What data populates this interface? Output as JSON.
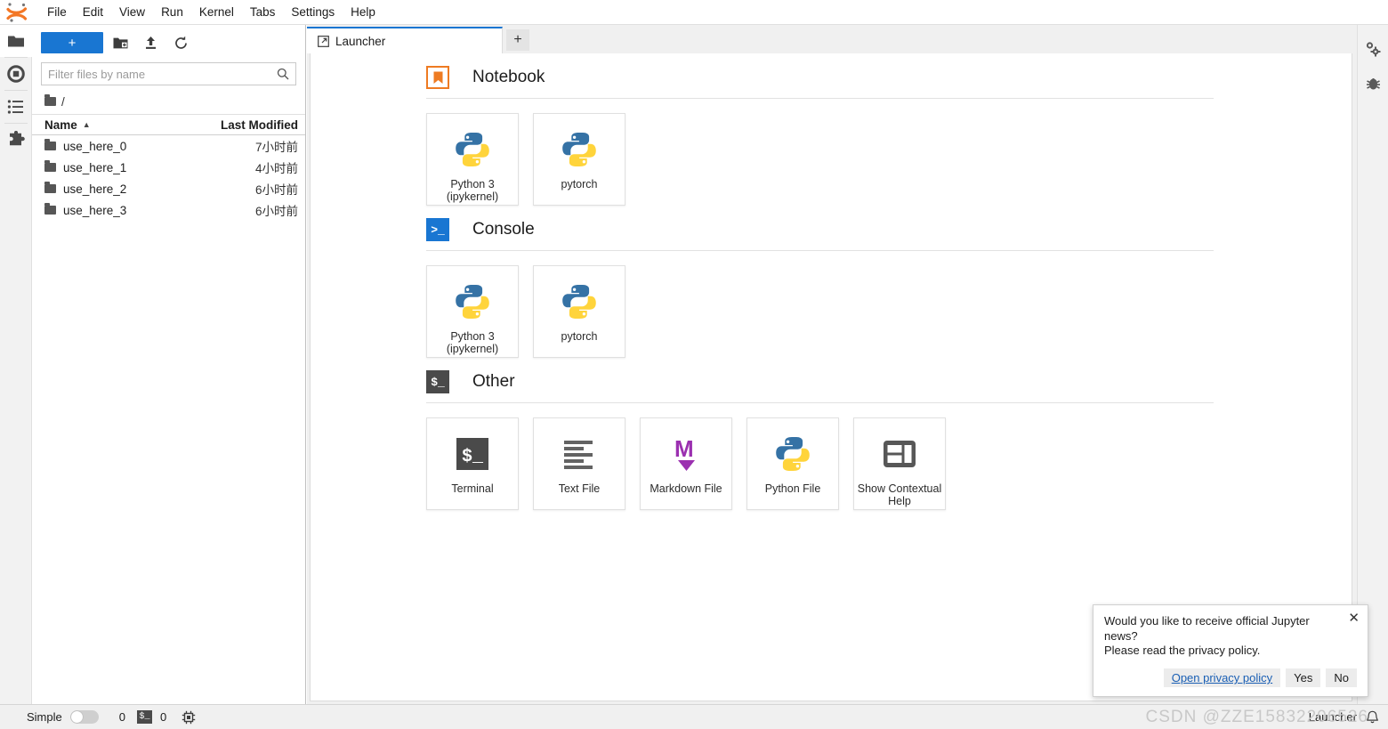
{
  "menubar": {
    "logo": "jupyter-logo",
    "items": [
      "File",
      "Edit",
      "View",
      "Run",
      "Kernel",
      "Tabs",
      "Settings",
      "Help"
    ]
  },
  "activitybar": {
    "items": [
      {
        "name": "file-browser",
        "icon": "folder-icon",
        "active": true
      },
      {
        "name": "running-sessions",
        "icon": "stop-circle-icon",
        "active": false
      },
      {
        "name": "commands",
        "icon": "list-icon",
        "active": false
      },
      {
        "name": "extension-manager",
        "icon": "puzzle-icon",
        "active": false
      }
    ]
  },
  "filebrowser": {
    "toolbar": {
      "new_label": "+",
      "new_folder_icon": "new-folder-icon",
      "upload_icon": "upload-icon",
      "refresh_icon": "refresh-icon"
    },
    "filter": {
      "placeholder": "Filter files by name",
      "value": "",
      "icon": "search-icon"
    },
    "breadcrumb": {
      "home_icon": "folder-icon",
      "path": "/"
    },
    "columns": [
      "Name",
      "Last Modified"
    ],
    "sort_caret": "▲",
    "rows": [
      {
        "name": "use_here_0",
        "modified": "7小时前"
      },
      {
        "name": "use_here_1",
        "modified": "4小时前"
      },
      {
        "name": "use_here_2",
        "modified": "6小时前"
      },
      {
        "name": "use_here_3",
        "modified": "6小时前"
      }
    ]
  },
  "dock": {
    "tab": {
      "label": "Launcher",
      "icon": "launcher-icon"
    },
    "add_tab_label": "+"
  },
  "launcher": {
    "sections": [
      {
        "title": "Notebook",
        "badge": "notebook-bookmark-icon",
        "badge_text": "",
        "cards": [
          {
            "label": "Python 3\n(ipykernel)",
            "icon": "python-icon"
          },
          {
            "label": "pytorch",
            "icon": "python-icon"
          }
        ]
      },
      {
        "title": "Console",
        "badge": "console-prompt-icon",
        "badge_text": ">_",
        "cards": [
          {
            "label": "Python 3\n(ipykernel)",
            "icon": "python-icon"
          },
          {
            "label": "pytorch",
            "icon": "python-icon"
          }
        ]
      },
      {
        "title": "Other",
        "badge": "terminal-prompt-icon",
        "badge_text": "$_",
        "cards": [
          {
            "label": "Terminal",
            "icon": "terminal-icon"
          },
          {
            "label": "Text File",
            "icon": "text-file-icon"
          },
          {
            "label": "Markdown File",
            "icon": "markdown-icon"
          },
          {
            "label": "Python File",
            "icon": "python-icon"
          },
          {
            "label": "Show Contextual Help",
            "icon": "contextual-help-icon"
          }
        ]
      }
    ]
  },
  "rightbar": {
    "items": [
      {
        "name": "property-inspector",
        "icon": "gears-icon"
      },
      {
        "name": "debugger",
        "icon": "bug-icon"
      }
    ]
  },
  "statusbar": {
    "simple_label": "Simple",
    "simple_on": false,
    "kernel_count": "0",
    "terminal_badge": "$_",
    "terminal_count": "0",
    "resource_icon": "cpu-chip-icon",
    "right_label": "Launcher",
    "notification_icon": "bell-icon"
  },
  "toast": {
    "message_line1": "Would you like to receive official Jupyter news?",
    "message_line2": "Please read the privacy policy.",
    "close_icon": "close-icon",
    "link_label": "Open privacy policy",
    "yes_label": "Yes",
    "no_label": "No"
  },
  "watermark": "CSDN @ZZE15832206526",
  "colors": {
    "accent_blue": "#1976d2",
    "notebook_orange": "#ee7b22",
    "markdown_purple": "#9b30b0",
    "terminal_dark": "#4a4a4a",
    "link_blue": "#1a5fb4"
  }
}
